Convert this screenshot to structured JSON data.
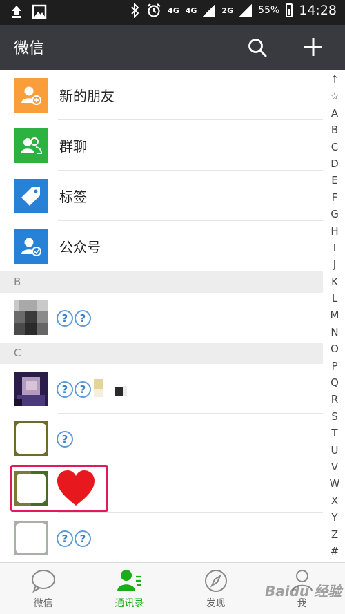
{
  "status_bar": {
    "network_4g": "4G",
    "network_4g_b": "4G",
    "network_2g": "2G",
    "battery": "55%",
    "time": "14:28"
  },
  "header": {
    "title": "微信"
  },
  "features": [
    {
      "label": "新的朋友",
      "icon": "add-friend-icon",
      "color": "#fa9d3b"
    },
    {
      "label": "群聊",
      "icon": "group-chat-icon",
      "color": "#2bb241"
    },
    {
      "label": "标签",
      "icon": "tag-icon",
      "color": "#2782d7"
    },
    {
      "label": "公众号",
      "icon": "official-account-icon",
      "color": "#2782d7"
    }
  ],
  "sections": [
    {
      "letter": "B"
    },
    {
      "letter": "C"
    }
  ],
  "alphabet": [
    "↑",
    "☆",
    "A",
    "B",
    "C",
    "D",
    "E",
    "F",
    "G",
    "H",
    "I",
    "J",
    "K",
    "L",
    "M",
    "N",
    "O",
    "P",
    "Q",
    "R",
    "S",
    "T",
    "U",
    "V",
    "W",
    "X",
    "Y",
    "Z",
    "#"
  ],
  "badge_glyph": "?",
  "tabs": [
    {
      "label": "微信",
      "icon": "chat-bubble-icon"
    },
    {
      "label": "通讯录",
      "icon": "contacts-icon",
      "active": true
    },
    {
      "label": "发现",
      "icon": "compass-icon"
    },
    {
      "label": "我",
      "icon": "me-icon"
    }
  ],
  "watermark": "Baidu 经验",
  "colors": {
    "accent": "#1aad19",
    "header": "#393a3f",
    "highlight": "#e3195c",
    "heart": "#e8191e"
  }
}
